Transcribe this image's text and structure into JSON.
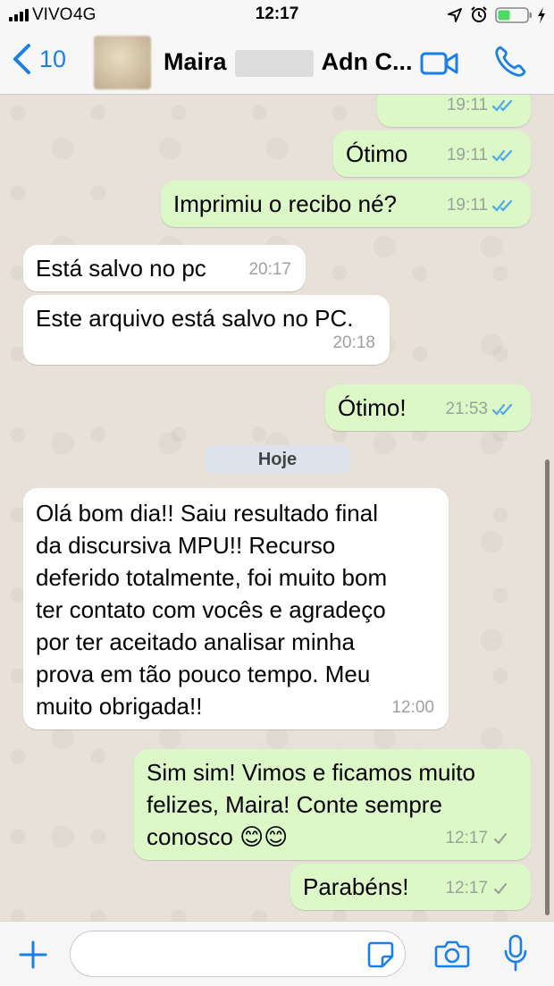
{
  "status_bar": {
    "carrier": "VIVO",
    "network": "4G",
    "time": "12:17",
    "icons": [
      "signal-icon",
      "location-icon",
      "alarm-icon",
      "battery-icon",
      "charging-icon"
    ]
  },
  "header": {
    "back_count": "10",
    "contact_first": "Maira",
    "contact_last": "Adn C...",
    "icons": [
      "chevron-left-icon",
      "video-call-icon",
      "phone-call-icon"
    ]
  },
  "colors": {
    "accent": "#1a7fe6",
    "outgoing_bubble": "#dcf8c6",
    "incoming_bubble": "#ffffff",
    "read_tick": "#4fa6e8",
    "sent_tick": "#9aa29a"
  },
  "messages": [
    {
      "direction": "out",
      "text": "",
      "time": "19:11",
      "status": "read"
    },
    {
      "direction": "out",
      "text": "Ótimo",
      "time": "19:11",
      "status": "read"
    },
    {
      "direction": "out",
      "text": "Imprimiu o recibo né?",
      "time": "19:11",
      "status": "read"
    },
    {
      "direction": "in",
      "text": "Está salvo no pc",
      "time": "20:17"
    },
    {
      "direction": "in",
      "text": "Este arquivo está salvo no PC.",
      "time": "20:18"
    },
    {
      "direction": "out",
      "text": "Ótimo!",
      "time": "21:53",
      "status": "read"
    },
    {
      "direction": "in",
      "text": "Olá bom dia!! Saiu resultado final\nda discursiva MPU!! Recurso\ndeferido totalmente, foi muito bom\nter contato com vocês e agradeço\npor ter aceitado analisar minha\nprova em tão pouco tempo. Meu\nmuito obrigada!!",
      "time": "12:00"
    },
    {
      "direction": "out",
      "text": "Sim sim! Vimos e ficamos muito\nfelizes, Maira! Conte sempre\nconosco 😊😊",
      "time": "12:17",
      "status": "delivered"
    },
    {
      "direction": "out",
      "text": "Parabéns!",
      "time": "12:17",
      "status": "delivered"
    }
  ],
  "date_divider": "Hoje",
  "input": {
    "value": "",
    "placeholder": "",
    "icons": [
      "plus-icon",
      "sticker-icon",
      "camera-icon",
      "microphone-icon"
    ]
  }
}
